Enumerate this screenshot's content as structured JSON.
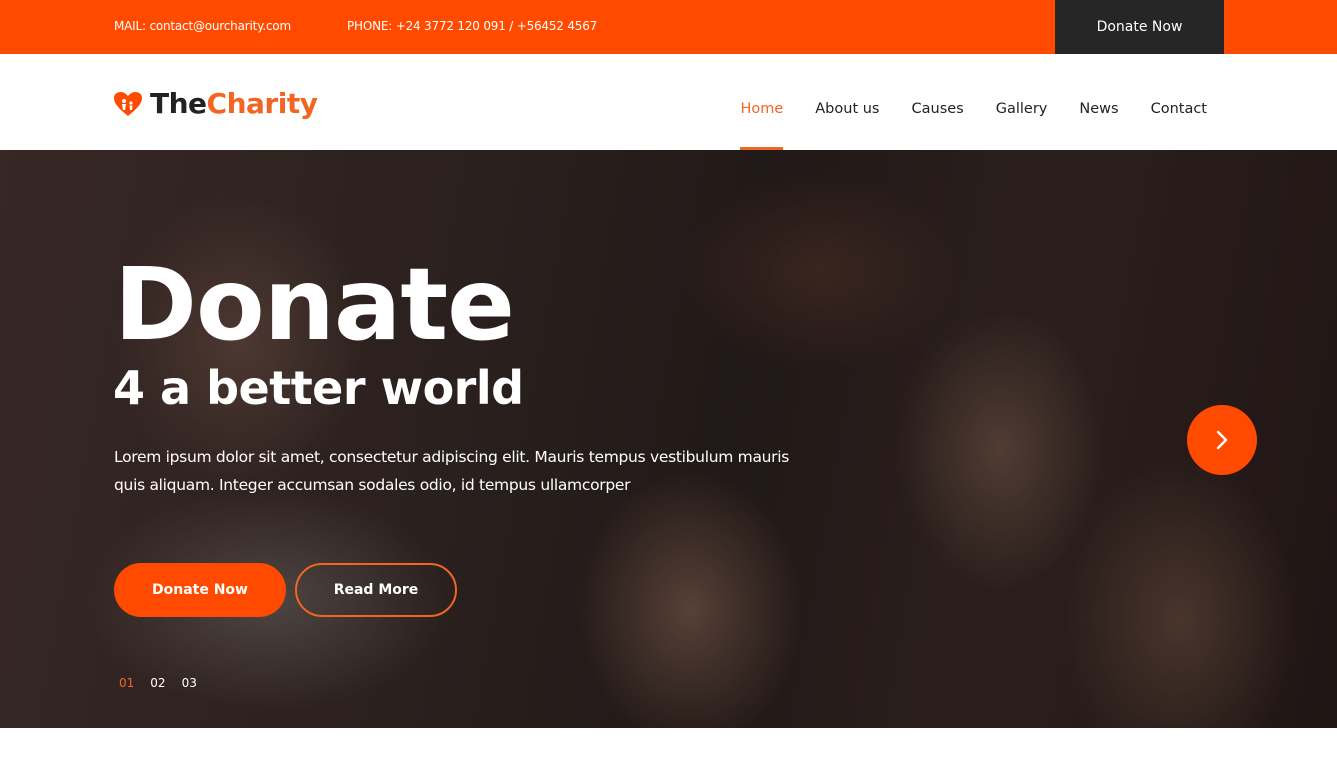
{
  "topbar": {
    "mail": "MAIL: contact@ourcharity.com",
    "phone": "PHONE: +24 3772 120 091 / +56452 4567",
    "donate_label": "Donate Now"
  },
  "logo": {
    "icon": "heart-people-icon",
    "text_part1": "The",
    "text_part2": "Charity"
  },
  "nav": {
    "items": [
      {
        "label": "Home",
        "active": true
      },
      {
        "label": "About us",
        "active": false
      },
      {
        "label": "Causes",
        "active": false
      },
      {
        "label": "Gallery",
        "active": false
      },
      {
        "label": "News",
        "active": false
      },
      {
        "label": "Contact",
        "active": false
      }
    ]
  },
  "hero": {
    "title": "Donate",
    "subtitle": "4 a better world",
    "description": "Lorem ipsum dolor sit amet, consectetur adipiscing elit. Mauris tempus vestibulum mauris quis aliquam. Integer accumsan sodales odio, id tempus ullamcorper",
    "primary_button": "Donate Now",
    "secondary_button": "Read More",
    "next_icon": "chevron-right-icon",
    "slides": [
      "01",
      "02",
      "03"
    ],
    "active_slide": "01"
  },
  "colors": {
    "accent": "#ff4a00",
    "accent_text": "#f26522",
    "dark": "#262626"
  }
}
